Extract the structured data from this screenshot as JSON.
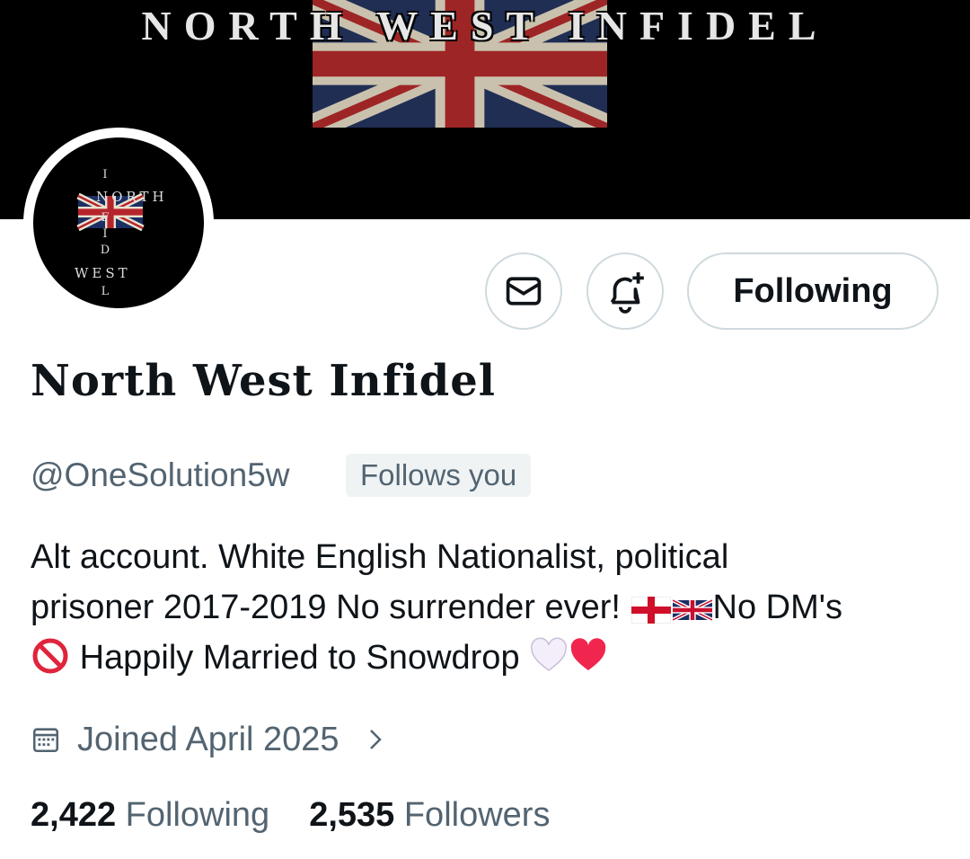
{
  "banner": {
    "title": "NORTH WEST INFIDEL"
  },
  "avatar": {
    "top_text": "NORTH",
    "bottom_text": "WEST",
    "vertical_text": "INFIDEL"
  },
  "actions": {
    "message_icon": "envelope-icon",
    "notify_icon": "bell-plus-icon",
    "follow_label": "Following"
  },
  "profile": {
    "display_name": "North West Infidel",
    "handle": "@OneSolution5w",
    "follows_you": "Follows you",
    "bio_line1": "Alt account. White English Nationalist, political",
    "bio_line2_a": "prisoner 2017-2019 No surrender ever!",
    "bio_line2_b": "No DM's",
    "bio_line3": "Happily Married to Snowdrop",
    "joined": "Joined April 2025"
  },
  "stats": {
    "following_count": "2,422",
    "following_label": "Following",
    "followers_count": "2,535",
    "followers_label": "Followers"
  },
  "colors": {
    "text": "#0f1419",
    "secondary": "#536471",
    "border": "#cfd9de",
    "pill": "#eff3f4"
  }
}
